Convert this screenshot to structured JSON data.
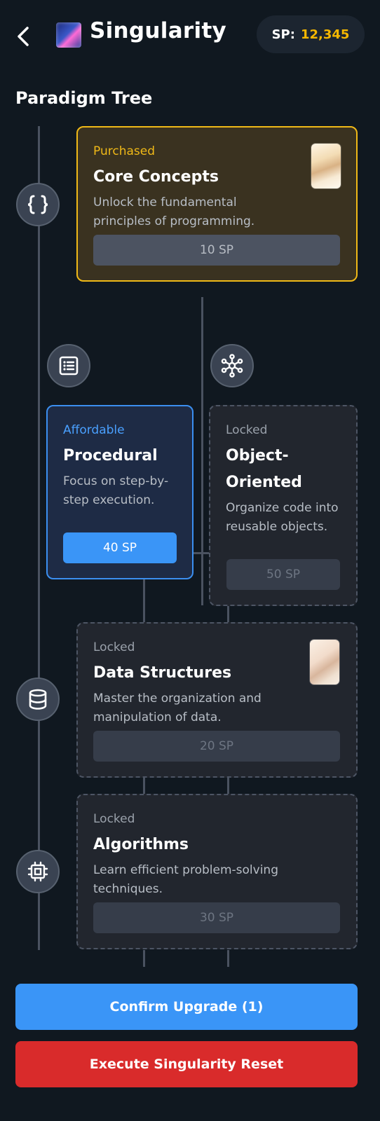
{
  "header": {
    "title": "Singularity",
    "sp_label": "SP:",
    "sp_value": "12,345",
    "back_icon": "chevron-left-icon",
    "logo": "galaxy-image"
  },
  "section_title": "Paradigm Tree",
  "colors": {
    "accent_blue": "#3a95f7",
    "purchased_gold": "#f0b917",
    "danger_red": "#d92b2b",
    "background": "#101820"
  },
  "nodes": [
    {
      "name": "Core Concepts",
      "icon": "code-braces-icon"
    },
    {
      "name": "Procedural",
      "icon": "list-icon"
    },
    {
      "name": "Object-Oriented",
      "icon": "network-hub-icon"
    },
    {
      "name": "Data Structures",
      "icon": "database-icon"
    },
    {
      "name": "Algorithms",
      "icon": "cpu-chip-icon"
    }
  ],
  "cards": {
    "core": {
      "status": "Purchased",
      "title": "Core Concepts",
      "description": "Unlock the fundamental principles of programming.",
      "cost": "10 SP"
    },
    "procedural": {
      "status": "Affordable",
      "title": "Procedural",
      "description": "Focus on step-by-step execution.",
      "cost": "40 SP"
    },
    "oop": {
      "status": "Locked",
      "title": "Object-Oriented",
      "description": "Organize code into reusable objects.",
      "cost": "50 SP"
    },
    "data": {
      "status": "Locked",
      "title": "Data Structures",
      "description": "Master the organization and manipulation of data.",
      "cost": "20 SP"
    },
    "algorithms": {
      "status": "Locked",
      "title": "Algorithms",
      "description": "Learn efficient problem-solving techniques.",
      "cost": "30 SP"
    }
  },
  "actions": {
    "confirm_label": "Confirm Upgrade (1)",
    "reset_label": "Execute Singularity Reset"
  }
}
